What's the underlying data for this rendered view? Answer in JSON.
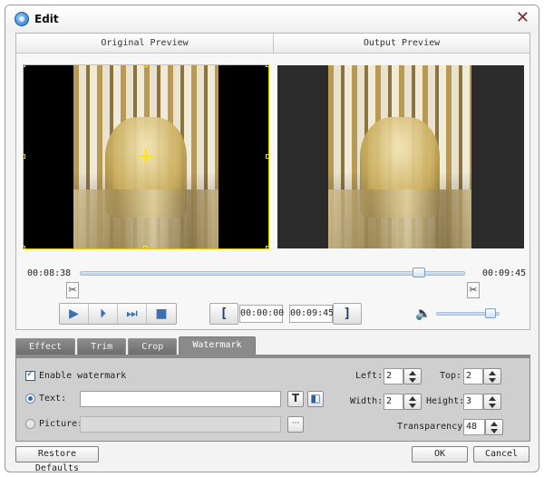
{
  "window": {
    "title": "Edit"
  },
  "icons": {
    "app": "app-icon",
    "close": "close-icon",
    "scissors": "scissors-icon",
    "play": "play-icon",
    "step": "step-forward-icon",
    "frame": "frame-step-icon",
    "stop": "stop-icon",
    "volume": "speaker-icon",
    "text_tool": "text-icon",
    "color_tool": "color-icon",
    "browse": "ellipsis-icon"
  },
  "preview": {
    "original_label": "Original Preview",
    "output_label": "Output Preview"
  },
  "timeline": {
    "start_time": "00:08:38",
    "end_time": "00:09:45",
    "position_fraction": 0.88
  },
  "controls": {
    "trim_start": "00:00:00",
    "trim_end": "00:09:45",
    "bracket_open": "[",
    "bracket_close": "]",
    "volume_fraction": 0.85
  },
  "tabs": [
    {
      "label": "Effect"
    },
    {
      "label": "Trim"
    },
    {
      "label": "Crop"
    },
    {
      "label": "Watermark"
    }
  ],
  "watermark": {
    "enable_label": "Enable watermark",
    "enable_checked": true,
    "text_label": "Text:",
    "text_value": "",
    "picture_label": "Picture:",
    "picture_value": "",
    "browse_label": "···",
    "text_tool_glyph": "T",
    "left_label": "Left:",
    "left_value": "2",
    "top_label": "Top:",
    "top_value": "2",
    "width_label": "Width:",
    "width_value": "2",
    "height_label": "Height:",
    "height_value": "3",
    "transparency_label": "Transparency:",
    "transparency_value": "48"
  },
  "footer": {
    "restore_label": "Restore Defaults",
    "ok_label": "OK",
    "cancel_label": "Cancel"
  },
  "colors": {
    "accent": "#3a6fb0",
    "crop_handle": "#ffe600",
    "tab_bg": "#8b8b8b"
  }
}
